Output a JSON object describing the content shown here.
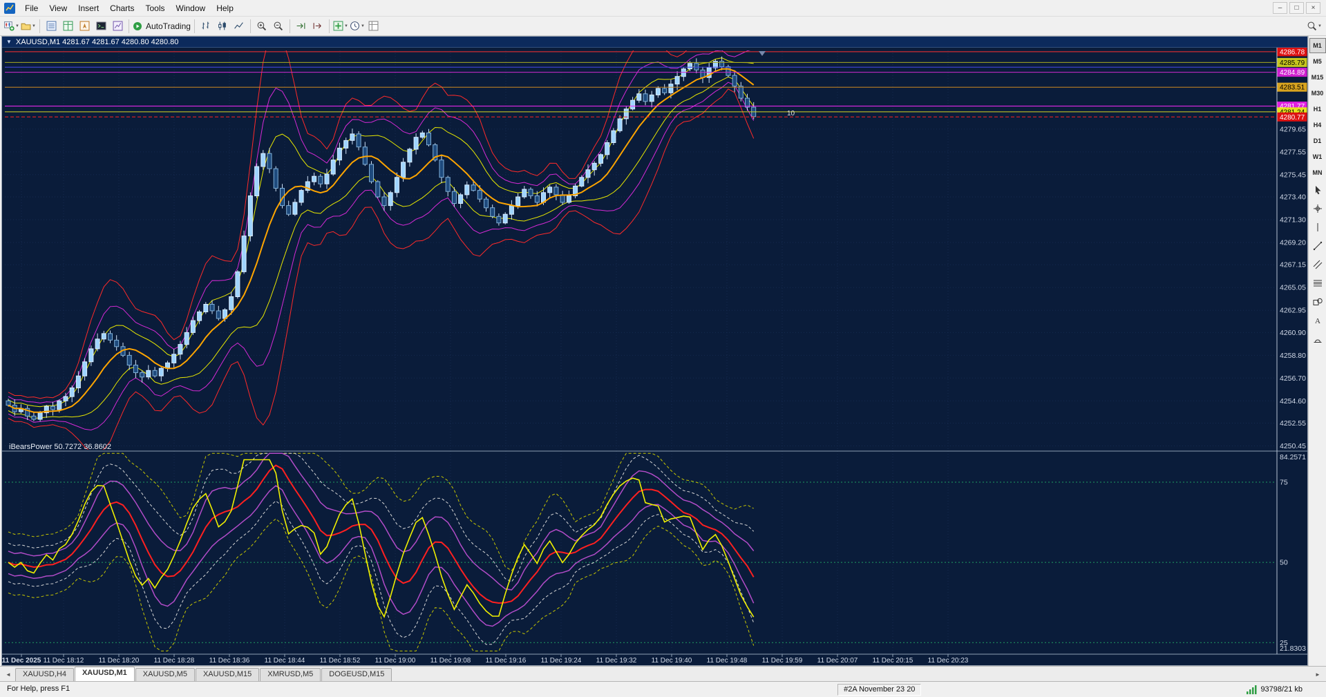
{
  "menu": {
    "items": [
      "File",
      "View",
      "Insert",
      "Charts",
      "Tools",
      "Window",
      "Help"
    ]
  },
  "window_controls": [
    {
      "name": "minimize",
      "glyph": "–"
    },
    {
      "name": "restore",
      "glyph": "□"
    },
    {
      "name": "close",
      "glyph": "×"
    }
  ],
  "toolbar": {
    "autotrading_label": "AutoTrading",
    "groups": [
      [
        "new-chart",
        "profiles"
      ],
      [
        "market-watch",
        "data-window",
        "navigator",
        "terminal",
        "strategy-tester"
      ],
      [
        "autotrading"
      ],
      [
        "bars-chart",
        "candles-chart",
        "line-chart"
      ],
      [
        "zoom-in",
        "zoom-out"
      ],
      [
        "auto-scroll",
        "chart-shift"
      ],
      [
        "indicators",
        "periods",
        "templates"
      ]
    ],
    "right": [
      "search"
    ],
    "dropdown_buttons": [
      "new-chart",
      "profiles",
      "indicators",
      "periods",
      "search"
    ]
  },
  "timeframes": {
    "items": [
      "M1",
      "M5",
      "M15",
      "M30",
      "H1",
      "H4",
      "D1",
      "W1",
      "MN"
    ],
    "active": "M1"
  },
  "side_tools": [
    "cursor",
    "crosshair",
    "vertical-line",
    "trendline",
    "channel",
    "fibonacci",
    "shapes",
    "text",
    "cycle"
  ],
  "chart": {
    "caption": "XAUUSD,M1  4281.67 4281.67 4280.80 4280.80",
    "symbol": "XAUUSD,M1",
    "annotation": "10",
    "first_open": 4254.6,
    "candles_close": [
      4254.2,
      4253.6,
      4253.9,
      4253.2,
      4252.9,
      4253.5,
      4254.1,
      4253.8,
      4254.6,
      4255.0,
      4255.8,
      4256.9,
      4258.2,
      4259.4,
      4260.3,
      4260.8,
      4260.2,
      4259.6,
      4258.8,
      4257.9,
      4257.2,
      4256.8,
      4257.4,
      4256.9,
      4257.6,
      4258.1,
      4258.9,
      4259.8,
      4260.9,
      4262.0,
      4262.8,
      4263.5,
      4262.9,
      4262.2,
      4263.0,
      4264.2,
      4266.5,
      4269.8,
      4273.5,
      4276.2,
      4277.4,
      4276.0,
      4274.2,
      4272.6,
      4271.8,
      4272.9,
      4274.0,
      4274.8,
      4275.3,
      4274.6,
      4275.5,
      4276.8,
      4277.9,
      4278.6,
      4279.2,
      4278.0,
      4276.4,
      4274.8,
      4273.4,
      4272.6,
      4273.8,
      4275.2,
      4276.6,
      4277.8,
      4278.9,
      4279.3,
      4278.2,
      4276.8,
      4275.2,
      4273.9,
      4272.8,
      4273.6,
      4274.5,
      4274.0,
      4273.2,
      4272.4,
      4271.6,
      4271.0,
      4271.8,
      4272.6,
      4273.4,
      4274.1,
      4273.5,
      4272.9,
      4273.8,
      4274.3,
      4273.6,
      4272.9,
      4273.5,
      4274.4,
      4275.2,
      4275.9,
      4276.5,
      4277.3,
      4278.4,
      4279.5,
      4280.6,
      4281.5,
      4282.3,
      4282.9,
      4282.2,
      4282.8,
      4283.4,
      4283.0,
      4283.8,
      4284.5,
      4285.2,
      4285.7,
      4285.1,
      4284.4,
      4285.3,
      4285.9,
      4285.4,
      4284.6,
      4283.6,
      4282.5,
      4281.67,
      4280.8
    ],
    "price_axis_labels": [
      "4279.65",
      "4277.55",
      "4275.45",
      "4273.40",
      "4271.30",
      "4269.20",
      "4267.15",
      "4265.05",
      "4262.95",
      "4260.90",
      "4258.80",
      "4256.70",
      "4254.60",
      "4252.55",
      "4250.45"
    ],
    "hlines": [
      {
        "label": "4286.78",
        "price": 4286.78,
        "color": "#ff3030",
        "tag_bg": "#dd1111",
        "tag_fg": "#ffffff",
        "dash": false
      },
      {
        "label": "4285.79",
        "price": 4285.79,
        "color": "#a8a820",
        "tag_bg": "#c6c61e",
        "tag_fg": "#000000",
        "dash": false
      },
      {
        "label": "4285.35",
        "price": 4285.35,
        "color": "#4848e8",
        "tag_bg": null,
        "tag_fg": null,
        "dash": false
      },
      {
        "label": "4284.89",
        "price": 4284.89,
        "color": "#d02ad0",
        "tag_bg": "#cf1fcf",
        "tag_fg": "#ffffff",
        "dash": false
      },
      {
        "label": "4283.51",
        "price": 4283.51,
        "color": "#d08a20",
        "tag_bg": "#d8a31f",
        "tag_fg": "#000000",
        "dash": false
      },
      {
        "label": "4281.77",
        "price": 4281.77,
        "color": "#ff2aff",
        "tag_bg": "#e01fe0",
        "tag_fg": "#ffffff",
        "dash": false
      },
      {
        "label": "4281.24",
        "price": 4281.24,
        "color": "#d8d820",
        "tag_bg": "#e4e41f",
        "tag_fg": "#000000",
        "dash": false
      },
      {
        "label": "4280.77",
        "price": 4280.77,
        "color": "#ff2020",
        "tag_bg": "#dd1111",
        "tag_fg": "#ffffff",
        "dash": true
      }
    ],
    "time_axis_labels": [
      "11 Dec 2025",
      "11 Dec 18:12",
      "11 Dec 18:20",
      "11 Dec 18:28",
      "11 Dec 18:36",
      "11 Dec 18:44",
      "11 Dec 18:52",
      "11 Dec 19:00",
      "11 Dec 19:08",
      "11 Dec 19:16",
      "11 Dec 19:24",
      "11 Dec 19:32",
      "11 Dec 19:40",
      "11 Dec 19:48",
      "11 Dec 19:59",
      "11 Dec 20:07",
      "11 Dec 20:15",
      "11 Dec 20:23"
    ]
  },
  "indicator": {
    "label": "iBearsPower 50.7272 36.8602",
    "name": "iBearsPower",
    "values": [
      "50.7272",
      "36.8602"
    ],
    "scale": {
      "max": "84.2571",
      "levels": [
        "75",
        "50",
        "25"
      ],
      "min": "21.8303"
    }
  },
  "tabs": {
    "scroll_left": "◄",
    "scroll_right": "►",
    "items": [
      {
        "label": "XAUUSD,H4",
        "active": false
      },
      {
        "label": "XAUUSD,M1",
        "active": true
      },
      {
        "label": "XAUUSD,M5",
        "active": false
      },
      {
        "label": "XAUUSD,M15",
        "active": false
      },
      {
        "label": "XMRUSD,M5",
        "active": false
      },
      {
        "label": "DOGEUSD,M15",
        "active": false
      }
    ]
  },
  "status": {
    "left": "For Help, press F1",
    "center": "#2A November 23 20",
    "right": "93798/21 kb"
  },
  "colors": {
    "chart_bg": "#0a1c3a",
    "grid": "#152a50",
    "axis_text": "#d2dae8",
    "band_red": "#ff2a2a",
    "band_magenta": "#d62ad6",
    "band_yellow": "#e8e800",
    "ma_orange": "#ffa500",
    "up_candle": "#9fd4ff",
    "up_stroke": "#d8ecff",
    "down_candle": "#1e4a7d",
    "down_stroke": "#7fb0d8",
    "wick": "#cfe2f8",
    "osc_yellow": "#f0f000",
    "osc_red": "#ff2020",
    "osc_purple": "#b24cc8",
    "osc_white": "#d8d8d8",
    "osc_ydash": "#c8c800",
    "level_green": "#1f9e63"
  }
}
